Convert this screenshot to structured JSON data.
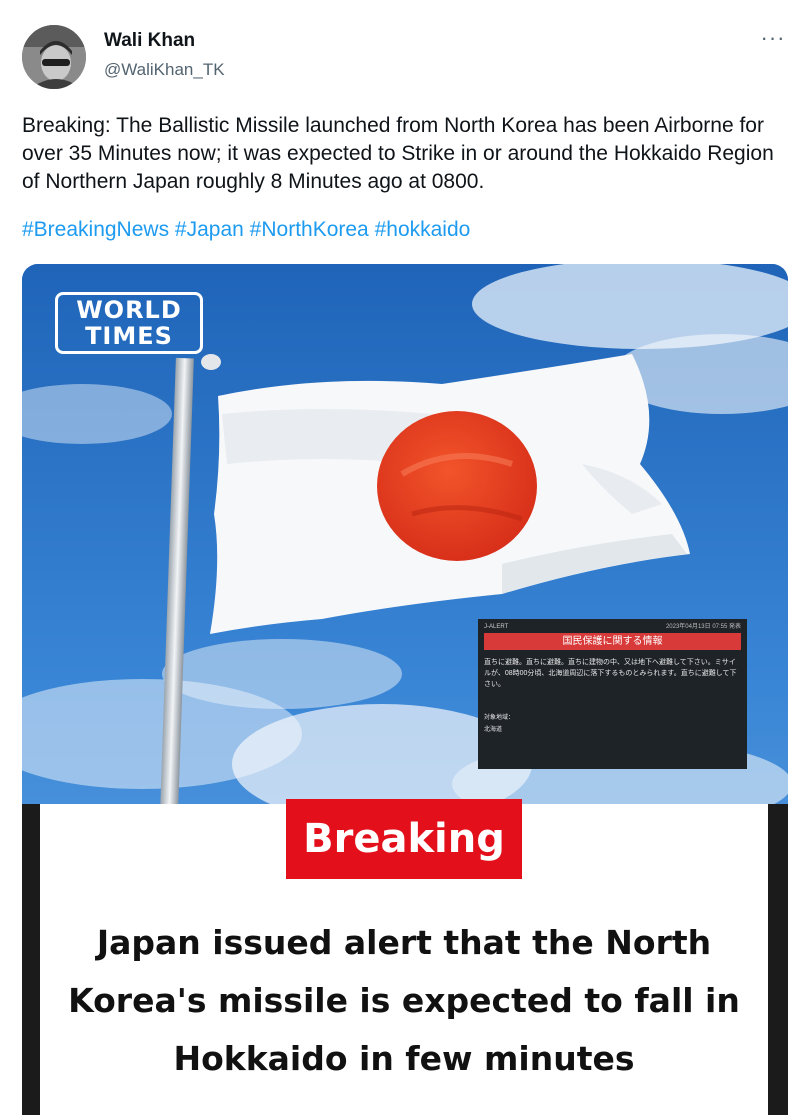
{
  "author": {
    "name": "Wali Khan",
    "handle": "@WaliKhan_TK"
  },
  "more_icon": "···",
  "tweet": {
    "text": "Breaking: The Ballistic Missile launched from North Korea has been Airborne for over 35 Minutes now; it was expected to Strike in or around the Hokkaido Region of Northern Japan roughly 8 Minutes ago at 0800.",
    "hashtags": [
      "#BreakingNews",
      "#Japan",
      "#NorthKorea",
      "#hokkaido"
    ]
  },
  "media": {
    "logo": {
      "line1": "WORLD",
      "line2": "TIMES"
    },
    "alert": {
      "header": "J-ALERT",
      "time": "2023年04月13日 07:55 発表",
      "title": "国民保護に関する情報",
      "body": "直ちに避難。直ちに避難。直ちに建物の中、又は地下へ避難して下さい。ミサイルが、08時00分頃、北海道周辺に落下するものとみられます。直ちに避難して下さい。",
      "label": "対象地域：",
      "area": "北海道"
    },
    "badge": "Breaking",
    "headline": "Japan issued alert that the North Korea's missile is expected to fall in Hokkaido in few minutes"
  },
  "colors": {
    "hashtag": "#1d9bf0",
    "badge": "#e3101b",
    "flag_red": "#e5391c",
    "sky": "#2a75c9"
  }
}
